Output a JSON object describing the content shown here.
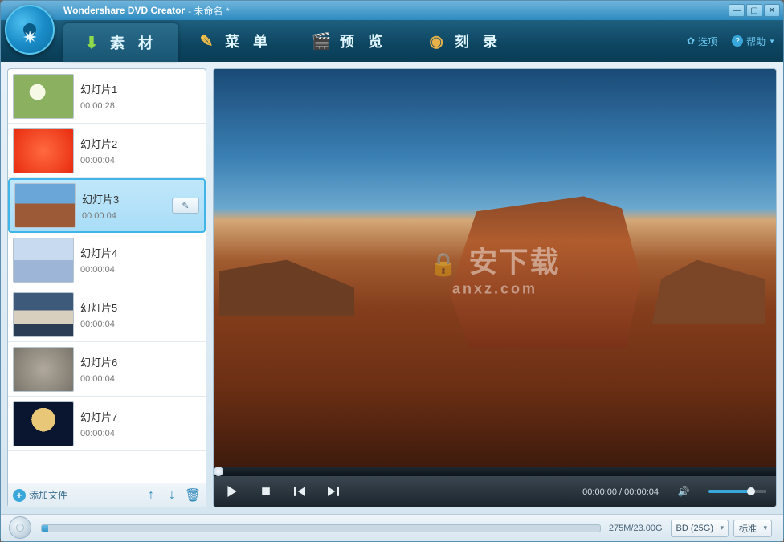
{
  "title": {
    "app": "Wondershare DVD Creator",
    "sep": " - ",
    "doc": "未命名 *"
  },
  "tabs": {
    "material": "素 材",
    "menu": "菜 单",
    "preview": "预 览",
    "burn": "刻 录"
  },
  "tools": {
    "options": "选项",
    "help": "帮助"
  },
  "slides": [
    {
      "name": "幻灯片1",
      "duration": "00:00:28",
      "thumb": "th-flower"
    },
    {
      "name": "幻灯片2",
      "duration": "00:00:04",
      "thumb": "th-red"
    },
    {
      "name": "幻灯片3",
      "duration": "00:00:04",
      "thumb": "th-mesa",
      "selected": true
    },
    {
      "name": "幻灯片4",
      "duration": "00:00:04",
      "thumb": "th-penguin"
    },
    {
      "name": "幻灯片5",
      "duration": "00:00:04",
      "thumb": "th-light"
    },
    {
      "name": "幻灯片6",
      "duration": "00:00:04",
      "thumb": "th-koala"
    },
    {
      "name": "幻灯片7",
      "duration": "00:00:04",
      "thumb": "th-jelly"
    }
  ],
  "footer": {
    "add": "添加文件"
  },
  "player": {
    "current": "00:00:00",
    "total": "00:00:04",
    "sep": " / "
  },
  "watermark": {
    "main": "安下载",
    "sub": "anxz.com"
  },
  "bottom": {
    "capacity": "275M/23.00G",
    "disc_type": "BD (25G)",
    "quality": "标准"
  }
}
